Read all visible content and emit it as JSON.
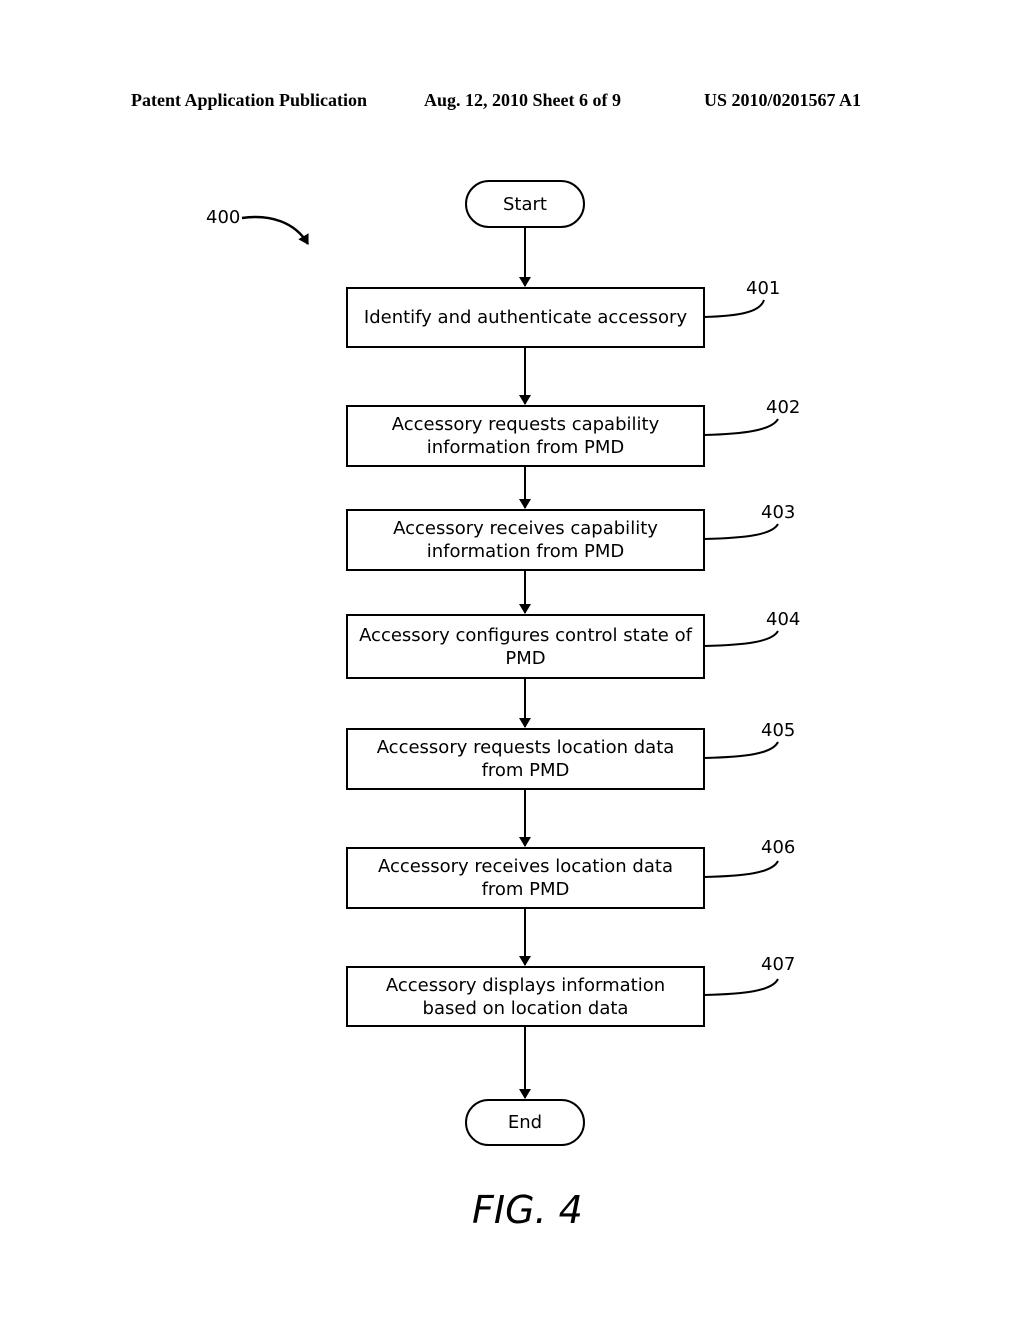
{
  "header": {
    "publication": "Patent Application Publication",
    "date_sheet": "Aug. 12, 2010  Sheet 6 of 9",
    "number": "US 2010/0201567 A1"
  },
  "diagram": {
    "ref": "400",
    "start": "Start",
    "end": "End",
    "steps": [
      {
        "id": "401",
        "text": "Identify and authenticate accessory"
      },
      {
        "id": "402",
        "text": "Accessory requests capability information from PMD"
      },
      {
        "id": "403",
        "text": "Accessory receives capability information from PMD"
      },
      {
        "id": "404",
        "text": "Accessory configures control state of PMD"
      },
      {
        "id": "405",
        "text": "Accessory requests location data from PMD"
      },
      {
        "id": "406",
        "text": "Accessory receives location data from PMD"
      },
      {
        "id": "407",
        "text": "Accessory displays information based on location data"
      }
    ],
    "figure_label": "FIG. 4"
  }
}
